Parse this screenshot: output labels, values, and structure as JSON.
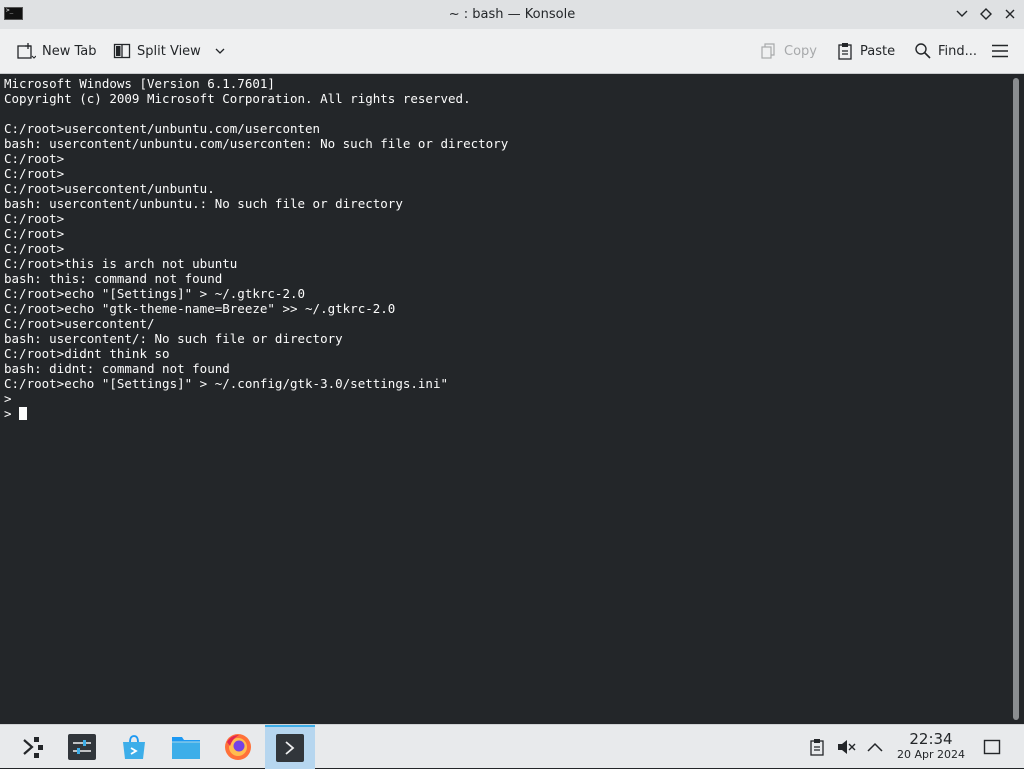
{
  "window": {
    "title": "~ : bash — Konsole"
  },
  "toolbar": {
    "new_tab": "New Tab",
    "split_view": "Split View",
    "copy": "Copy",
    "paste": "Paste",
    "find": "Find..."
  },
  "terminal": {
    "lines": [
      "Microsoft Windows [Version 6.1.7601]",
      "Copyright (c) 2009 Microsoft Corporation. All rights reserved.",
      "",
      "C:/root>usercontent/unbuntu.com/userconten",
      "bash: usercontent/unbuntu.com/userconten: No such file or directory",
      "C:/root>",
      "C:/root>",
      "C:/root>usercontent/unbuntu.",
      "bash: usercontent/unbuntu.: No such file or directory",
      "C:/root>",
      "C:/root>",
      "C:/root>",
      "C:/root>this is arch not ubuntu",
      "bash: this: command not found",
      "C:/root>echo \"[Settings]\" > ~/.gtkrc-2.0",
      "C:/root>echo \"gtk-theme-name=Breeze\" >> ~/.gtkrc-2.0",
      "C:/root>usercontent/",
      "bash: usercontent/: No such file or directory",
      "C:/root>didnt think so",
      "bash: didnt: command not found",
      "C:/root>echo \"[Settings]\" > ~/.config/gtk-3.0/settings.ini\"",
      ">"
    ],
    "prompt": "> "
  },
  "taskbar": {
    "time": "22:34",
    "date": "20 Apr 2024"
  },
  "colors": {
    "terminal_bg": "#232629",
    "terminal_fg": "#fcfcfc",
    "accent": "#3daee9"
  }
}
